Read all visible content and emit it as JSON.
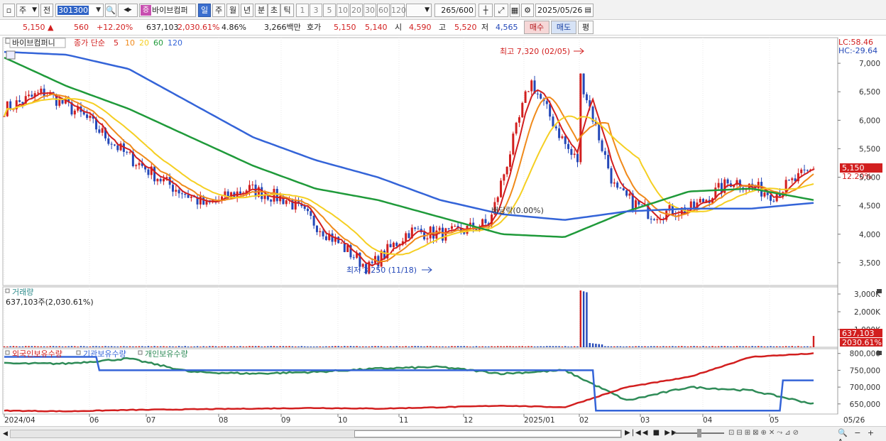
{
  "toolbar": {
    "market": "주",
    "prev": "전",
    "code": "301300",
    "name": "바이브컴퍼",
    "name_tag": "증",
    "periods": [
      "일",
      "주",
      "월",
      "년",
      "분",
      "초",
      "틱"
    ],
    "active_period": "일",
    "intervals": [
      "1",
      "3",
      "5",
      "10",
      "20",
      "30",
      "60",
      "120"
    ],
    "count": "265",
    "count_total": "/600",
    "date": "2025/05/26"
  },
  "quote": {
    "price": "5,150",
    "change": "560",
    "change_pct": "+12.20%",
    "volume": "637,103",
    "volume_pct": "2,030.61%",
    "turnover_pct": "4.86%",
    "amount": "3,266백만",
    "hoga_label": "호가",
    "ask": "5,150",
    "bid": "5,140",
    "open_label": "시",
    "open": "4,590",
    "high_label": "고",
    "high": "5,520",
    "low_label": "저",
    "low": "4,565",
    "buy_btn": "매수",
    "sell_btn": "매도",
    "eval_btn": "평"
  },
  "price_panel": {
    "legend_name": "바이브컴퍼니",
    "legend_type": "종가 단순",
    "ma_labels": [
      "5",
      "10",
      "20",
      "60",
      "120"
    ],
    "ma_colors": [
      "#d21f1f",
      "#f08a1a",
      "#f5cf22",
      "#1f9a3a",
      "#3464d8"
    ],
    "lc": "LC:58.46",
    "hc": "HC:-29.64",
    "high_annot": "최고 7,320 (02/05)",
    "low_annot": "최저 3,250 (11/18)",
    "event_annot": "배당락(0.00%)",
    "last_price_badge": "5,150",
    "last_pct_badge": "12.20%",
    "y_ticks": [
      "7,000",
      "6,500",
      "6,000",
      "5,500",
      "5,000",
      "4,500",
      "4,000",
      "3,500"
    ]
  },
  "volume_panel": {
    "title": "거래량",
    "value": "637,103주(2,030.61%)",
    "y_ticks": [
      "3,000K",
      "2,000K",
      "1,000K"
    ],
    "badge_value": "637,103",
    "badge_pct": "2030.61%"
  },
  "holding_panel": {
    "legend": [
      "외국인보유수량",
      "기관보유수량",
      "개인보유수량"
    ],
    "colors": [
      "#d21f1f",
      "#3464d8",
      "#2e8b57"
    ],
    "y_ticks": [
      "800,000",
      "750,000",
      "700,000",
      "650,000"
    ]
  },
  "x_axis": [
    "2024/04",
    "06",
    "07",
    "08",
    "09",
    "10",
    "11",
    "12",
    "2025/01",
    "02",
    "03",
    "04",
    "05",
    "05/26"
  ],
  "chart_data": {
    "type": "line",
    "title": "",
    "price_series": [
      {
        "name": "5",
        "color": "#d21f1f"
      },
      {
        "name": "10",
        "color": "#f08a1a"
      },
      {
        "name": "20",
        "color": "#f5cf22"
      },
      {
        "name": "60",
        "color": "#1f9a3a"
      },
      {
        "name": "120",
        "color": "#3464d8"
      }
    ],
    "x": [
      "2024/04",
      "06",
      "07",
      "08",
      "09",
      "10",
      "11",
      "12",
      "2025/01",
      "02",
      "03",
      "04",
      "05",
      "05/26"
    ],
    "close_approx": [
      6200,
      6500,
      6050,
      5400,
      4900,
      4500,
      4800,
      4600,
      4000,
      3400,
      4050,
      4000,
      4200,
      6700,
      5400,
      4800,
      4350,
      4450,
      4950,
      4700,
      5150
    ],
    "ma120_approx": [
      7200,
      7150,
      6900,
      6300,
      5700,
      5300,
      5000,
      4600,
      4350,
      4250,
      4400,
      4450,
      4450,
      4550
    ],
    "ma60_approx": [
      7100,
      6600,
      6200,
      5700,
      5200,
      4800,
      4600,
      4300,
      4000,
      3950,
      4400,
      4750,
      4800,
      4600
    ],
    "high": {
      "value": 7320,
      "date": "02/05"
    },
    "low": {
      "value": 3250,
      "date": "11/18"
    },
    "last": 5150,
    "ylim": [
      3100,
      7450
    ],
    "volume_last": 637103,
    "volume_peak_approx": 3200000,
    "holding_ylim": [
      620000,
      810000
    ],
    "foreign_holding_approx": [
      630000,
      628000,
      632000,
      634000,
      636000,
      638000,
      636000,
      640000,
      645000,
      640000,
      700000,
      730000,
      790000,
      800000
    ],
    "institution_holding_approx": [
      790000,
      790000,
      750000,
      750000,
      750000,
      750000,
      750000,
      750000,
      750000,
      750000,
      630000,
      630000,
      630000,
      720000
    ],
    "individual_holding_approx": [
      770000,
      770000,
      785000,
      745000,
      740000,
      745000,
      755000,
      760000,
      740000,
      750000,
      660000,
      700000,
      690000,
      650000
    ]
  }
}
